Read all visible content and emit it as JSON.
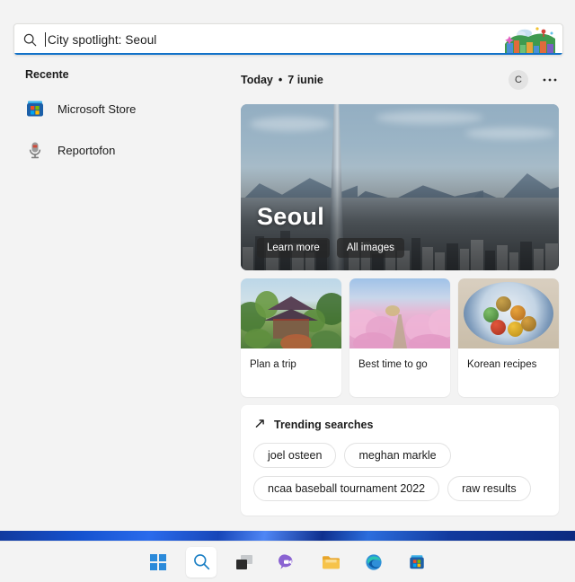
{
  "search": {
    "icon": "search-icon",
    "value": "City spotlight: Seoul",
    "badge_icon": "city-spotlight-illustration",
    "accent_color": "#1272c9"
  },
  "sidebar": {
    "title": "Recente",
    "items": [
      {
        "label": "Microsoft Store",
        "icon": "microsoft-store-icon"
      },
      {
        "label": "Reportofon",
        "icon": "microphone-icon"
      }
    ]
  },
  "header": {
    "today_label": "Today",
    "separator": "•",
    "date": "7 iunie",
    "avatar_initial": "C",
    "more_icon": "ellipsis-icon"
  },
  "hero": {
    "title": "Seoul",
    "buttons": [
      {
        "label": "Learn more"
      },
      {
        "label": "All images"
      }
    ],
    "image_alt": "seoul-skyline-photo"
  },
  "tiles": [
    {
      "caption": "Plan a trip",
      "image_alt": "korean-pavilion-photo"
    },
    {
      "caption": "Best time to go",
      "image_alt": "cherry-blossom-path-photo"
    },
    {
      "caption": "Korean recipes",
      "image_alt": "korean-sweets-plate-photo"
    }
  ],
  "trending": {
    "icon": "trending-arrow-icon",
    "title": "Trending searches",
    "chips": [
      "joel osteen",
      "meghan markle",
      "ncaa baseball tournament 2022",
      "raw results"
    ]
  },
  "taskbar": {
    "items": [
      {
        "name": "start-button",
        "icon": "windows-logo-icon",
        "active": false
      },
      {
        "name": "search-button",
        "icon": "search-icon",
        "active": true
      },
      {
        "name": "task-view-button",
        "icon": "task-view-icon",
        "active": false
      },
      {
        "name": "chat-button",
        "icon": "chat-icon",
        "active": false
      },
      {
        "name": "file-explorer-button",
        "icon": "folder-icon",
        "active": false
      },
      {
        "name": "edge-button",
        "icon": "edge-icon",
        "active": false
      },
      {
        "name": "store-button",
        "icon": "microsoft-store-icon",
        "active": false
      }
    ]
  }
}
